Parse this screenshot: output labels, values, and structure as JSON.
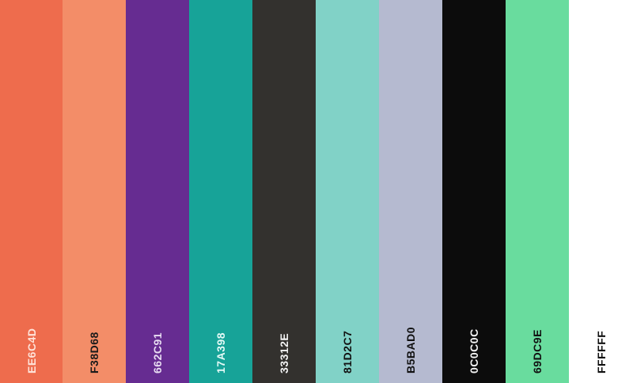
{
  "palette": {
    "swatches": [
      {
        "label": "EE6C4D",
        "color": "#EE6C4D",
        "text_color": "#FFE3D9"
      },
      {
        "label": "F38D68",
        "color": "#F38D68",
        "text_color": "#1A1A1A"
      },
      {
        "label": "662C91",
        "color": "#662C91",
        "text_color": "#E8DDF2"
      },
      {
        "label": "17A398",
        "color": "#17A398",
        "text_color": "#E6FAF7"
      },
      {
        "label": "33312E",
        "color": "#33312E",
        "text_color": "#F2F2F2"
      },
      {
        "label": "81D2C7",
        "color": "#81D2C7",
        "text_color": "#111111"
      },
      {
        "label": "B5BAD0",
        "color": "#B5BAD0",
        "text_color": "#111111"
      },
      {
        "label": "0C0C0C",
        "color": "#0C0C0C",
        "text_color": "#F2F2F2"
      },
      {
        "label": "69DC9E",
        "color": "#69DC9E",
        "text_color": "#111111"
      },
      {
        "label": "FFFFFF",
        "color": "#FFFFFF",
        "text_color": "#111111"
      }
    ]
  }
}
